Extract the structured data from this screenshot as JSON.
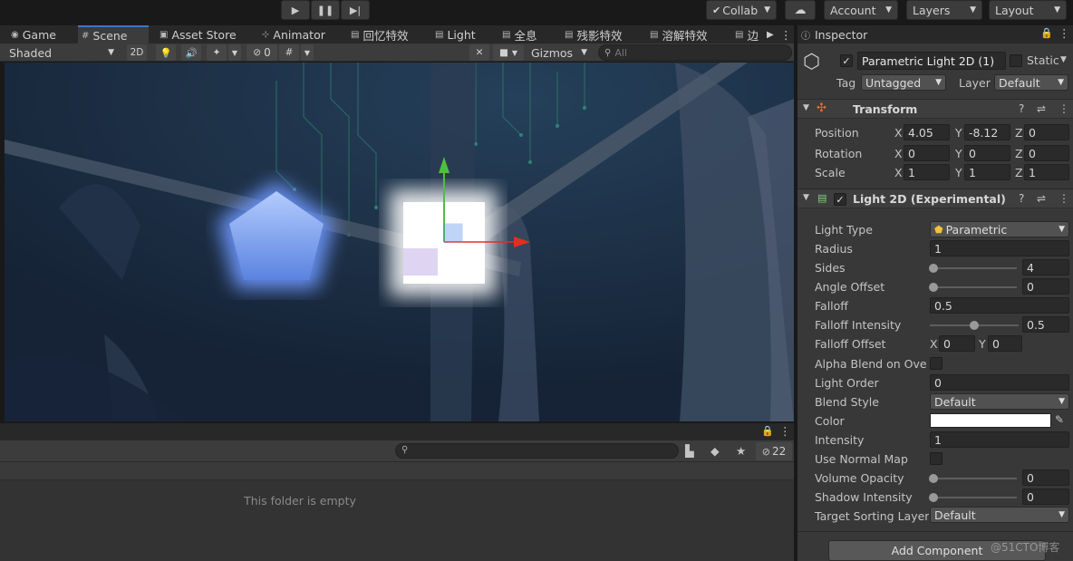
{
  "toolbar": {
    "collab_label": "Collab",
    "account_label": "Account",
    "layers_label": "Layers",
    "layout_label": "Layout"
  },
  "tabs": [
    {
      "label": "Game"
    },
    {
      "label": "Scene"
    },
    {
      "label": "Asset Store"
    },
    {
      "label": "Animator"
    },
    {
      "label": "回忆特效"
    },
    {
      "label": "Light"
    },
    {
      "label": "全息"
    },
    {
      "label": "残影特效"
    },
    {
      "label": "溶解特效"
    },
    {
      "label": "边"
    }
  ],
  "scene_toolbar": {
    "shading_mode": "Shaded",
    "mode_2d": "2D",
    "hidden_count": "0",
    "gizmos_label": "Gizmos",
    "search_placeholder": "All"
  },
  "project": {
    "hidden_count": "22",
    "empty_message": "This folder is empty"
  },
  "inspector": {
    "tab_label": "Inspector",
    "object_name": "Parametric Light 2D (1)",
    "static_label": "Static",
    "tag_label": "Tag",
    "tag_value": "Untagged",
    "layer_label": "Layer",
    "layer_value": "Default",
    "transform": {
      "title": "Transform",
      "position_label": "Position",
      "rotation_label": "Rotation",
      "scale_label": "Scale",
      "position": {
        "x": "4.05",
        "y": "-8.12",
        "z": "0"
      },
      "rotation": {
        "x": "0",
        "y": "0",
        "z": "0"
      },
      "scale": {
        "x": "1",
        "y": "1",
        "z": "1"
      }
    },
    "light2d": {
      "title": "Light 2D (Experimental)",
      "light_type_label": "Light Type",
      "light_type_value": "Parametric",
      "radius_label": "Radius",
      "radius_value": "1",
      "sides_label": "Sides",
      "sides_value": "4",
      "sides_fraction": 0.0,
      "angle_offset_label": "Angle Offset",
      "angle_offset_value": "0",
      "angle_offset_fraction": 0.0,
      "falloff_label": "Falloff",
      "falloff_value": "0.5",
      "falloff_intensity_label": "Falloff Intensity",
      "falloff_intensity_value": "0.5",
      "falloff_intensity_fraction": 0.5,
      "falloff_offset_label": "Falloff Offset",
      "falloff_offset_x": "0",
      "falloff_offset_y": "0",
      "alpha_blend_label": "Alpha Blend on Overl",
      "light_order_label": "Light Order",
      "light_order_value": "0",
      "blend_style_label": "Blend Style",
      "blend_style_value": "Default",
      "color_label": "Color",
      "color_value": "#ffffff",
      "intensity_label": "Intensity",
      "intensity_value": "1",
      "use_normal_map_label": "Use Normal Map",
      "volume_opacity_label": "Volume Opacity",
      "volume_opacity_value": "0",
      "volume_opacity_fraction": 0.0,
      "shadow_intensity_label": "Shadow Intensity",
      "shadow_intensity_value": "0",
      "shadow_intensity_fraction": 0.0,
      "target_sorting_layer_label": "Target Sorting Layer",
      "target_sorting_layer_value": "Default"
    },
    "add_component_label": "Add Component"
  },
  "watermark": "@51CTO博客",
  "colors": {
    "accent": "#3a79bb",
    "light_blue": "#7aa6ff",
    "gizmo_x": "#e03020",
    "gizmo_y": "#4ec040"
  }
}
